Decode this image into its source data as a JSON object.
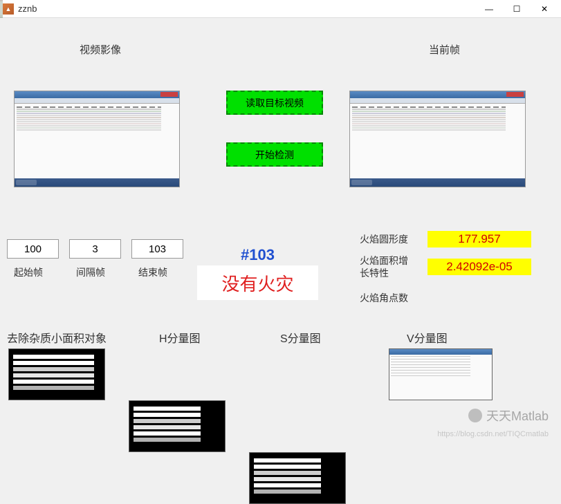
{
  "window": {
    "title": "zznb",
    "icon_name": "matlab-icon"
  },
  "sections": {
    "video_label": "视频影像",
    "current_frame_label": "当前帧"
  },
  "buttons": {
    "read_video": "读取目标视频",
    "start_detect": "开始检测"
  },
  "params": {
    "start_frame": {
      "value": "100",
      "label": "起始帧"
    },
    "interval_frame": {
      "value": "3",
      "label": "间隔帧"
    },
    "end_frame": {
      "value": "103",
      "label": "结束帧"
    }
  },
  "status": {
    "frame_num": "#103",
    "result": "没有火灾"
  },
  "metrics": {
    "roundness": {
      "label": "火焰圆形度",
      "value": "177.957"
    },
    "area_growth": {
      "label": "火焰面积增\n长特性",
      "value": "2.42092e-05"
    },
    "corner_count": {
      "label": "火焰角点数"
    }
  },
  "components": {
    "remove_small": "去除杂质小面积对象",
    "h_comp": "H分量图",
    "s_comp": "S分量图",
    "v_comp": "V分量图"
  },
  "watermark": {
    "text": "天天Matlab",
    "url": "https://blog.csdn.net/TIQCmatlab"
  }
}
